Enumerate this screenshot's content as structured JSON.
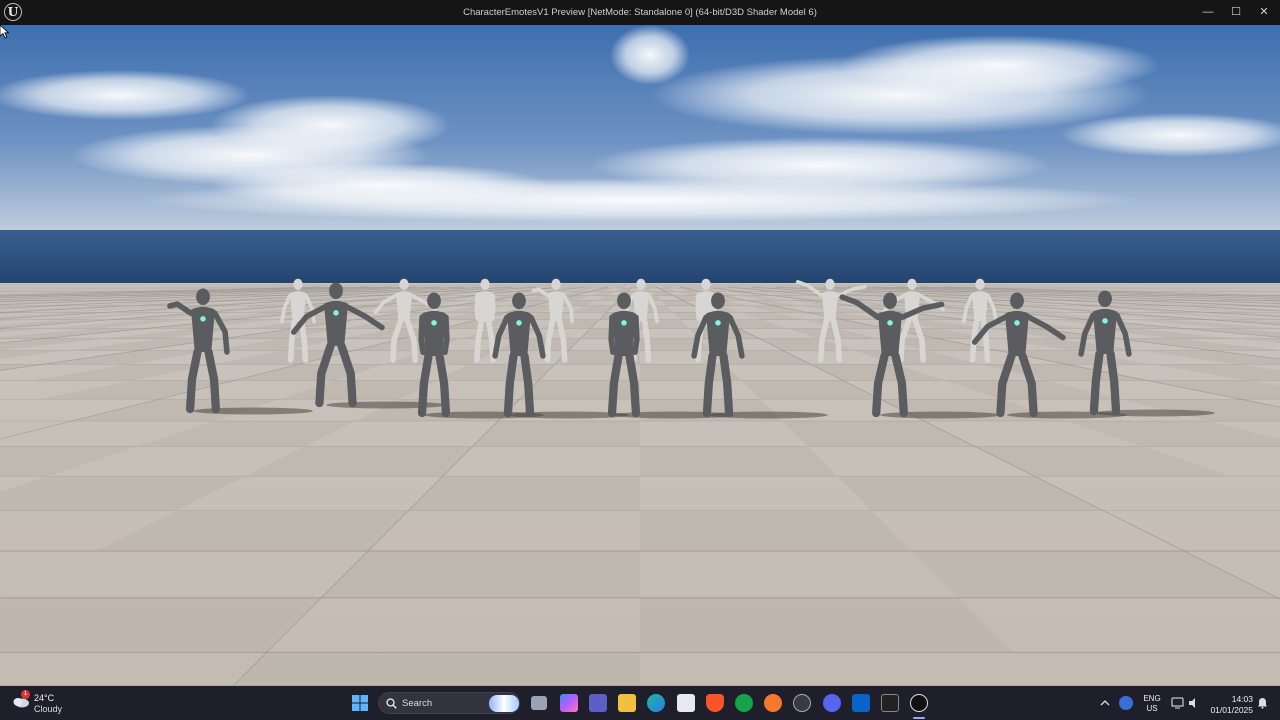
{
  "window": {
    "title": "CharacterEmotesV1 Preview [NetMode: Standalone 0]  (64-bit/D3D Shader Model 6)",
    "app_icon": "unreal-engine-logo-icon",
    "app_glyph": "U",
    "minimize_glyph": "—",
    "maximize_glyph": "☐",
    "close_glyph": "✕"
  },
  "viewport": {
    "scene": "checkered-floor-with-dancing-mannequins",
    "sky_top": "#3f6fae",
    "sky_horizon": "#c9d4e0",
    "ocean": "#2d4f7e",
    "floor_light": "#cfc8bf",
    "floor_dark": "#bdb6ad",
    "dark_mannequin_color": "#5a5c60",
    "light_mannequin_color": "#d8d6d2",
    "emissive_color": "#7ff5e0"
  },
  "taskbar": {
    "weather": {
      "temp": "24°C",
      "condition": "Cloudy",
      "badge": "1"
    },
    "search": {
      "label": "Search"
    },
    "language": {
      "line1": "ENG",
      "line2": "US"
    },
    "clock": {
      "time": "14:03",
      "date": "01/01/2025"
    }
  }
}
